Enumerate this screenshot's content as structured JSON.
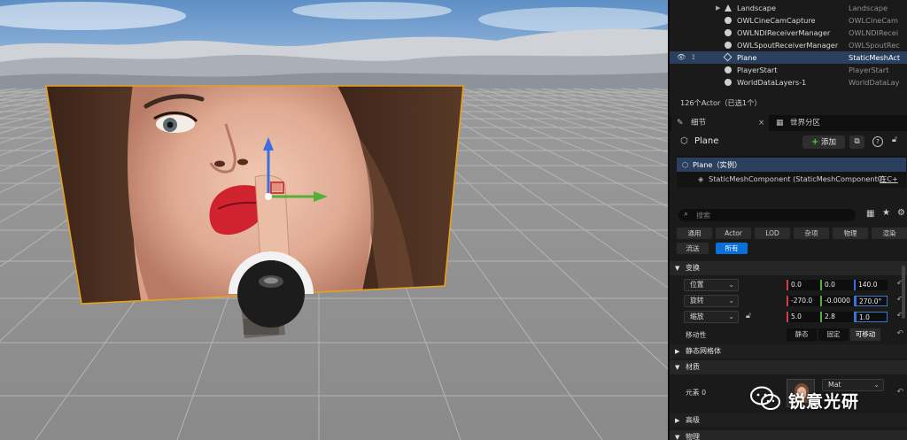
{
  "outliner": {
    "rows": [
      {
        "name": "Landscape",
        "type": "Landscape",
        "icon": "landscape-icon"
      },
      {
        "name": "OWLCineCamCapture",
        "type": "OWLCineCam",
        "icon": "actor-icon"
      },
      {
        "name": "OWLNDIReceiverManager",
        "type": "OWLNDIRecei",
        "icon": "actor-icon"
      },
      {
        "name": "OWLSpoutReceiverManager",
        "type": "OWLSpoutRec",
        "icon": "actor-icon"
      },
      {
        "name": "Plane",
        "type": "StaticMeshAct",
        "icon": "static-mesh-icon",
        "selected": true
      },
      {
        "name": "PlayerStart",
        "type": "PlayerStart",
        "icon": "actor-icon"
      },
      {
        "name": "WorldDataLayers-1",
        "type": "WorldDataLay",
        "icon": "actor-icon"
      }
    ],
    "count_text": "126个Actor（已选1个）"
  },
  "tabs": [
    {
      "label": "细节",
      "icon": "details-icon",
      "close": "×"
    },
    {
      "label": "世界分区",
      "icon": "world-partition-icon"
    }
  ],
  "details": {
    "actor_name": "Plane",
    "add_label": "添加",
    "component_root": "Plane（实例）",
    "component_child": "StaticMeshComponent (StaticMeshComponent0)",
    "component_child_link": "在C+",
    "search_placeholder": "搜索",
    "filters_row1": [
      "通用",
      "Actor",
      "LOD",
      "杂项",
      "物理",
      "渲染"
    ],
    "filters_row2": [
      "流送",
      "所有"
    ],
    "active_filter": "所有"
  },
  "transform": {
    "section_label": "变换",
    "location": {
      "label": "位置",
      "x": "0.0",
      "y": "0.0",
      "z": "140.0"
    },
    "rotation": {
      "label": "旋转",
      "x": "-270.0",
      "y": "-0.0000",
      "z": "270.0°"
    },
    "scale": {
      "label": "缩放",
      "x": "5.0",
      "y": "2.8",
      "z": "1.0"
    },
    "mobility": {
      "label": "移动性",
      "options": [
        "静态",
        "固定",
        "可移动"
      ],
      "selected": "可移动"
    }
  },
  "sections": {
    "static_mesh": "静态网格体",
    "materials": "材质",
    "element0": "元素 0",
    "material_value": "Mat",
    "advanced": "高级",
    "physics": "物理"
  },
  "watermark": {
    "text": "锐意光研"
  },
  "colors": {
    "selection": "#2b3f5e",
    "accent_blue": "#0a70d8",
    "add_green": "#5fc34a",
    "axis_x": "#d33f3f",
    "axis_y": "#55b03b",
    "axis_z": "#3b6fe0",
    "outline_orange": "#e8a020"
  }
}
